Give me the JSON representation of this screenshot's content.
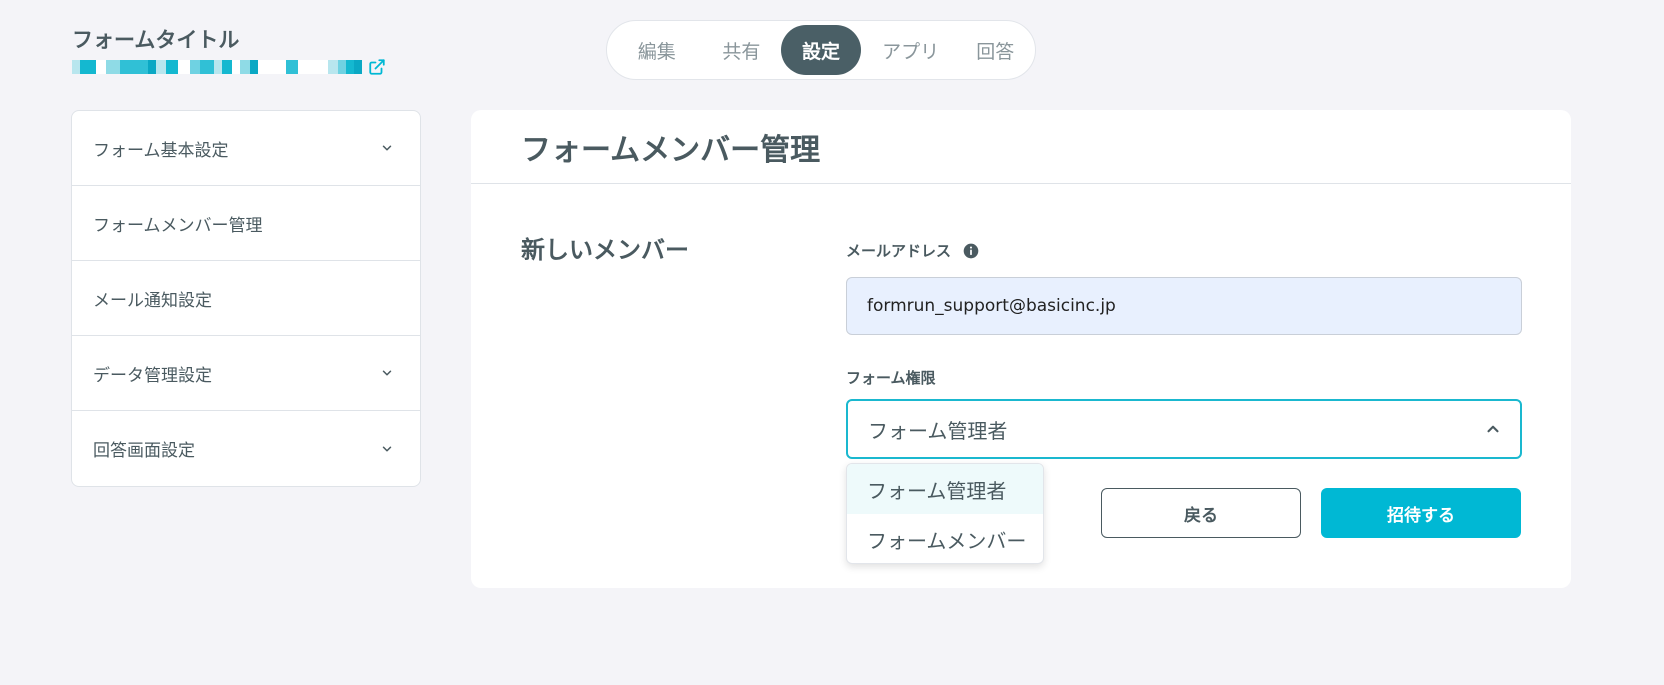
{
  "header": {
    "form_title": "フォームタイトル"
  },
  "nav": {
    "tabs": [
      {
        "label": "編集"
      },
      {
        "label": "共有"
      },
      {
        "label": "設定"
      },
      {
        "label": "アプリ"
      },
      {
        "label": "回答"
      }
    ],
    "active": "設定"
  },
  "sidebar": {
    "items": [
      {
        "label": "フォーム基本設定",
        "icon": "chevron-down-icon"
      },
      {
        "label": "フォームメンバー管理"
      },
      {
        "label": "メール通知設定"
      },
      {
        "label": "データ管理設定",
        "icon": "chevron-down-icon"
      },
      {
        "label": "回答画面設定",
        "icon": "chevron-down-icon"
      }
    ]
  },
  "panel": {
    "title": "フォームメンバー管理",
    "section_label": "新しいメンバー",
    "email": {
      "label": "メールアドレス",
      "value": "formrun_support@basicinc.jp",
      "icon": "info-icon"
    },
    "permission": {
      "label": "フォーム権限",
      "selected": "フォーム管理者",
      "options": [
        "フォーム管理者",
        "フォームメンバー"
      ]
    },
    "back_label": "戻る",
    "invite_label": "招待する"
  },
  "colors": {
    "accent": "#00b8d4",
    "nav_active": "#4a5f66",
    "text": "#4a5a60",
    "background": "#f4f4f8"
  }
}
